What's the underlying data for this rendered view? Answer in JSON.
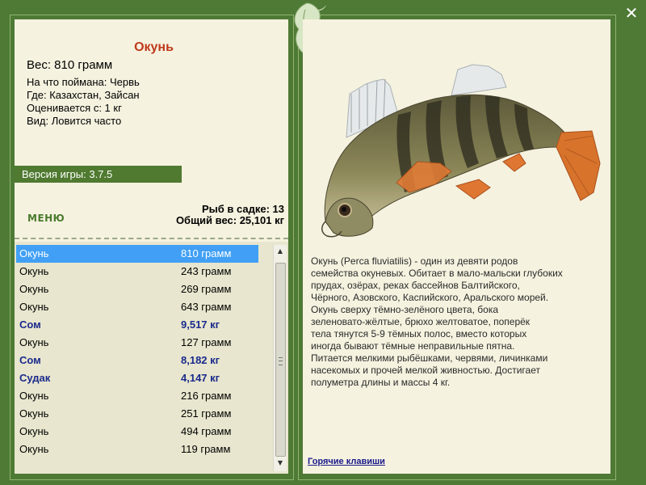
{
  "fish": {
    "title": "Окунь",
    "weight": "Вес: 810 грамм",
    "caught_on": "На что поймана: Червь",
    "location": "Где: Казахстан, Зайсан",
    "valued_from": "Оценивается с: 1 кг",
    "frequency": "Вид: Ловится часто"
  },
  "version": "Версия игры: 3.7.5",
  "menu_label": "МЕНЮ",
  "stats": {
    "count": "Рыб в садке: 13",
    "total": "Общий вес: 25,101 кг"
  },
  "list": [
    {
      "name": "Окунь",
      "weight": "810 грамм",
      "selected": true,
      "big": false
    },
    {
      "name": "Окунь",
      "weight": "243 грамм",
      "selected": false,
      "big": false
    },
    {
      "name": "Окунь",
      "weight": "269 грамм",
      "selected": false,
      "big": false
    },
    {
      "name": "Окунь",
      "weight": "643 грамм",
      "selected": false,
      "big": false
    },
    {
      "name": "Сом",
      "weight": "9,517 кг",
      "selected": false,
      "big": true
    },
    {
      "name": "Окунь",
      "weight": "127 грамм",
      "selected": false,
      "big": false
    },
    {
      "name": "Сом",
      "weight": "8,182 кг",
      "selected": false,
      "big": true
    },
    {
      "name": "Судак",
      "weight": "4,147 кг",
      "selected": false,
      "big": true
    },
    {
      "name": "Окунь",
      "weight": "216 грамм",
      "selected": false,
      "big": false
    },
    {
      "name": "Окунь",
      "weight": "251 грамм",
      "selected": false,
      "big": false
    },
    {
      "name": "Окунь",
      "weight": "494 грамм",
      "selected": false,
      "big": false
    },
    {
      "name": "Окунь",
      "weight": "119 грамм",
      "selected": false,
      "big": false
    }
  ],
  "description_lines": [
    "Окунь (Perca fluviatilis) - один из девяти родов",
    "семейства окуневых. Обитает в мало-мальски глубоких",
    "прудах, озёрах, реках бассейнов Балтийского,",
    "Чёрного, Азовского, Каспийского, Аральского морей.",
    "Окунь сверху тёмно-зелёного цвета, бока",
    "зеленовато-жёлтые, брюхо желтоватое, поперёк",
    "тела тянутся 5-9 тёмных полос, вместо которых",
    "иногда бывают тёмные неправильные пятна.",
    "Питается мелкими рыбёшками, червями, личинками",
    "насекомых и прочей мелкой живностью. Достигает",
    "полуметра длины и массы 4 кг."
  ],
  "hotkeys_label": "Горячие клавиши",
  "icons": {
    "close": "close-icon",
    "ornament": "leaf-ornament-icon",
    "scroll_up": "arrow-up-icon",
    "scroll_down": "arrow-down-icon"
  },
  "colors": {
    "frame": "#4e7a35",
    "panel": "#f5f2df",
    "title": "#c0391b",
    "selection": "#41a0f5",
    "big_fish": "#1a2a8c"
  }
}
